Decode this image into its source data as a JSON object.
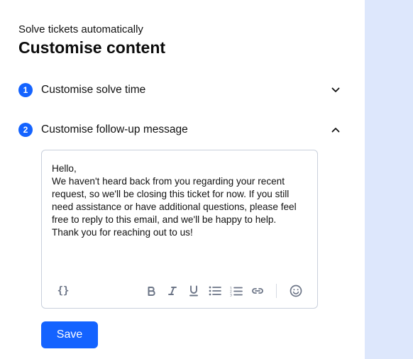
{
  "header": {
    "eyebrow": "Solve tickets automatically",
    "title": "Customise content"
  },
  "steps": [
    {
      "number": "1",
      "label": "Customise solve time",
      "expanded": false,
      "toggle_icon": "chevron-down-icon"
    },
    {
      "number": "2",
      "label": "Customise follow-up message",
      "expanded": true,
      "toggle_icon": "chevron-up-icon"
    }
  ],
  "editor": {
    "content": "Hello,\nWe haven't heard back from you regarding your recent request, so we'll be closing this ticket for now. If you still need assistance or have additional questions, please feel free to reply to this email, and we'll be happy to help.\nThank you for reaching out to us!",
    "toolbar": {
      "variable_label": "{}",
      "buttons": [
        "variable-icon",
        "bold-icon",
        "italic-icon",
        "underline-icon",
        "bulleted-list-icon",
        "numbered-list-icon",
        "link-icon",
        "emoji-icon"
      ]
    }
  },
  "actions": {
    "save_label": "Save"
  },
  "colors": {
    "accent": "#1463ff",
    "side_panel": "#dde7fc",
    "border": "#c9d0dc",
    "toolbar_icon": "#6b7486"
  }
}
